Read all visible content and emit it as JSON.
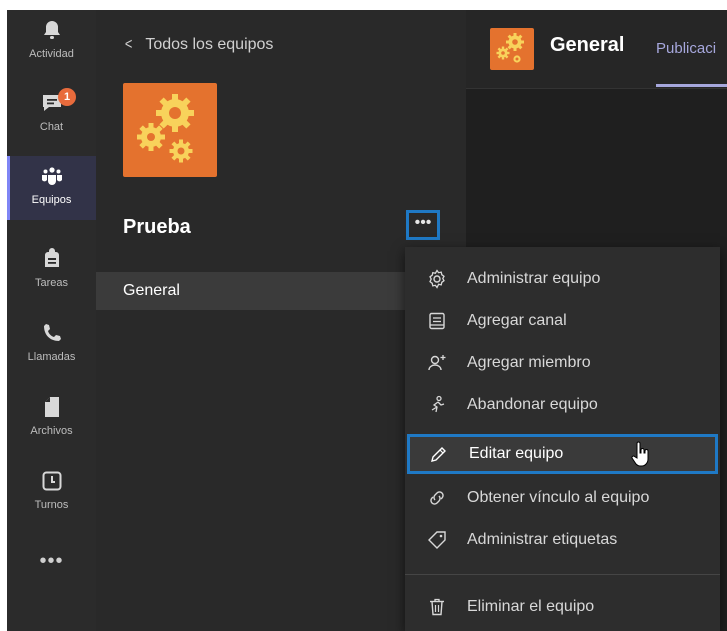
{
  "rail": {
    "items": [
      {
        "label": "Actividad",
        "icon": "bell-icon"
      },
      {
        "label": "Chat",
        "icon": "chat-icon",
        "badge": "1"
      },
      {
        "label": "Equipos",
        "icon": "teams-icon",
        "active": true
      },
      {
        "label": "Tareas",
        "icon": "backpack-icon"
      },
      {
        "label": "Llamadas",
        "icon": "phone-icon"
      },
      {
        "label": "Archivos",
        "icon": "file-icon"
      },
      {
        "label": "Turnos",
        "icon": "clock-icon"
      }
    ],
    "more": "•••"
  },
  "teamcol": {
    "back_label": "Todos los equipos",
    "back_icon": "chevron-left-icon",
    "team_name": "Prueba",
    "more_label": "•••",
    "channels": [
      {
        "label": "General"
      }
    ]
  },
  "main": {
    "channel_title": "General",
    "tab_label": "Publicaci"
  },
  "menu": {
    "items": [
      {
        "label": "Administrar equipo",
        "icon": "gear-icon"
      },
      {
        "label": "Agregar canal",
        "icon": "channel-icon"
      },
      {
        "label": "Agregar miembro",
        "icon": "add-person-icon"
      },
      {
        "label": "Abandonar equipo",
        "icon": "leave-icon"
      },
      {
        "label": "Editar equipo",
        "icon": "pencil-icon",
        "highlighted": true
      },
      {
        "label": "Obtener vínculo al equipo",
        "icon": "link-icon"
      },
      {
        "label": "Administrar etiquetas",
        "icon": "tag-icon"
      },
      {
        "label": "Eliminar el equipo",
        "icon": "trash-icon"
      }
    ]
  },
  "colors": {
    "accent": "#7f85f5",
    "highlight_border": "#1f79c5",
    "team_orange": "#e4722e",
    "badge": "#e86b3c"
  }
}
